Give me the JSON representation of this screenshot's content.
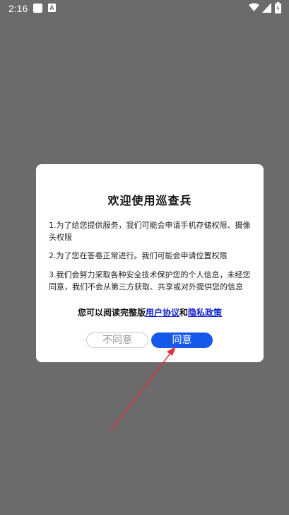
{
  "status_bar": {
    "time": "2:16",
    "notif_label": "A"
  },
  "dialog": {
    "title": "欢迎使用巡查兵",
    "paragraphs": [
      "1.为了给您提供服务，我们可能会申请手机存储权限、摄像头权限",
      "2.为了您在答卷正常进行。我们可能会申请位置权限",
      "3.我们会努力采取各种安全技术保护您的个人信息，未经您同意，我们不会从第三方获取、共享或对外提供您的信息"
    ],
    "agreement": {
      "prefix": "您可以阅读完整版",
      "user_agreement": "用户协议",
      "and": "和",
      "privacy_policy": "隐私政策"
    },
    "disagree_label": "不同意",
    "agree_label": "同意"
  },
  "colors": {
    "backdrop": "#6b6b6b",
    "agree_button": "#1559ea",
    "link": "#1122cc",
    "arrow": "#e0323c"
  }
}
